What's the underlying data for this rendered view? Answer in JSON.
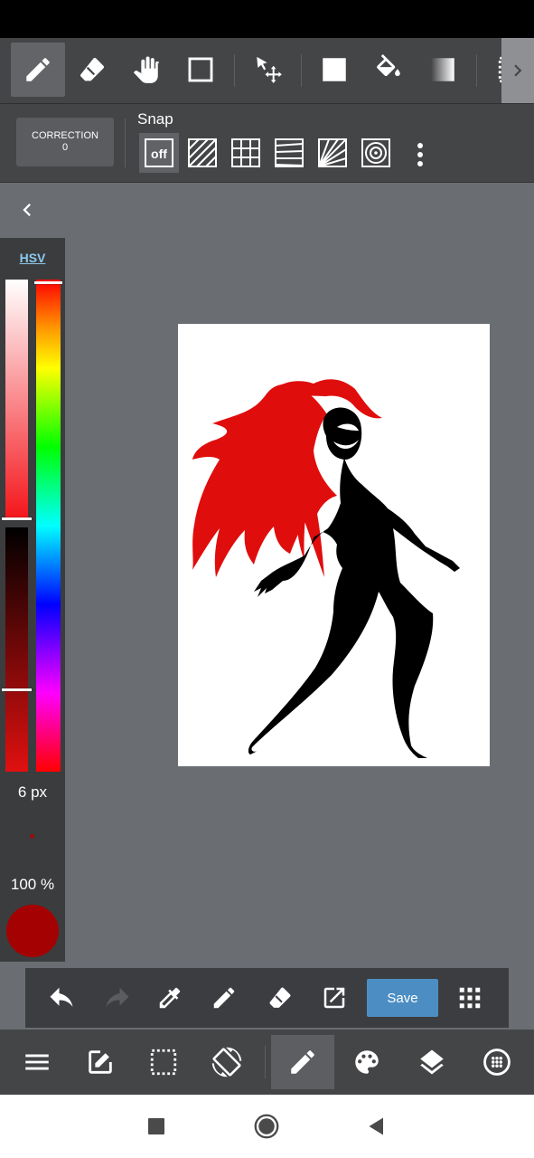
{
  "toolbar": {
    "tools": [
      "pencil-icon",
      "eraser-icon",
      "hand-icon",
      "rectangle-select-icon",
      "move-icon",
      "fill-shape-icon",
      "bucket-icon",
      "gradient-icon",
      "selection-icon"
    ],
    "more": "chevron-right-icon"
  },
  "correction": {
    "label": "CORRECTION",
    "value": "0"
  },
  "snap": {
    "title": "Snap",
    "off_label": "off",
    "options": [
      "snap-off",
      "parallel-lines",
      "grid",
      "vanishing-parallel",
      "perspective-radial",
      "concentric-circles"
    ]
  },
  "color_panel": {
    "mode_tab": "HSV",
    "brush_size": "6 px",
    "opacity": "100 %",
    "current_color": "#a40202"
  },
  "quick_bar": {
    "save_label": "Save",
    "tools": [
      "undo-icon",
      "redo-icon",
      "eyedropper-icon",
      "pen-icon",
      "eraser-icon",
      "share-icon",
      "grid-menu-icon"
    ]
  },
  "bottom_bar": {
    "tools": [
      "menu-icon",
      "edit-icon",
      "selection-icon",
      "rotate-icon",
      "brush-icon",
      "palette-icon",
      "layers-icon",
      "material-icon"
    ]
  },
  "colors": {
    "accent": "#4c8ec3",
    "toolbar": "#444547",
    "workspace": "#6a6e73"
  }
}
